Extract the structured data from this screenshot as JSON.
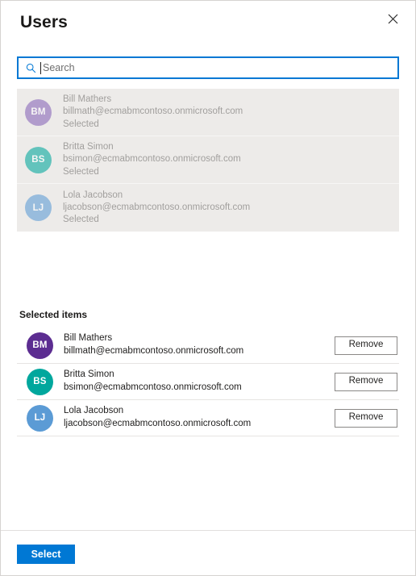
{
  "dialog": {
    "title": "Users",
    "close_icon": "close-icon"
  },
  "search": {
    "placeholder": "Search",
    "value": "",
    "icon": "search-icon"
  },
  "picker_list": {
    "items": [
      {
        "initials": "BM",
        "name": "Bill Mathers",
        "email": "billmath@ecmabmcontoso.onmicrosoft.com",
        "status": "Selected",
        "color": "#8764B8"
      },
      {
        "initials": "BS",
        "name": "Britta Simon",
        "email": "bsimon@ecmabmcontoso.onmicrosoft.com",
        "status": "Selected",
        "color": "#00A79D"
      },
      {
        "initials": "LJ",
        "name": "Lola Jacobson",
        "email": "ljacobson@ecmabmcontoso.onmicrosoft.com",
        "status": "Selected",
        "color": "#5B9BD5"
      }
    ]
  },
  "selected_items": {
    "heading": "Selected items",
    "remove_label": "Remove",
    "items": [
      {
        "initials": "BM",
        "name": "Bill Mathers",
        "email": "billmath@ecmabmcontoso.onmicrosoft.com",
        "color": "#5C2D91"
      },
      {
        "initials": "BS",
        "name": "Britta Simon",
        "email": "bsimon@ecmabmcontoso.onmicrosoft.com",
        "color": "#00A79D"
      },
      {
        "initials": "LJ",
        "name": "Lola Jacobson",
        "email": "ljacobson@ecmabmcontoso.onmicrosoft.com",
        "color": "#5B9BD5"
      }
    ]
  },
  "footer": {
    "select_label": "Select"
  },
  "colors": {
    "accent": "#0078D4",
    "list_background": "#EDEBE9",
    "disabled_text": "#A19F9D",
    "border": "#8A8886"
  }
}
